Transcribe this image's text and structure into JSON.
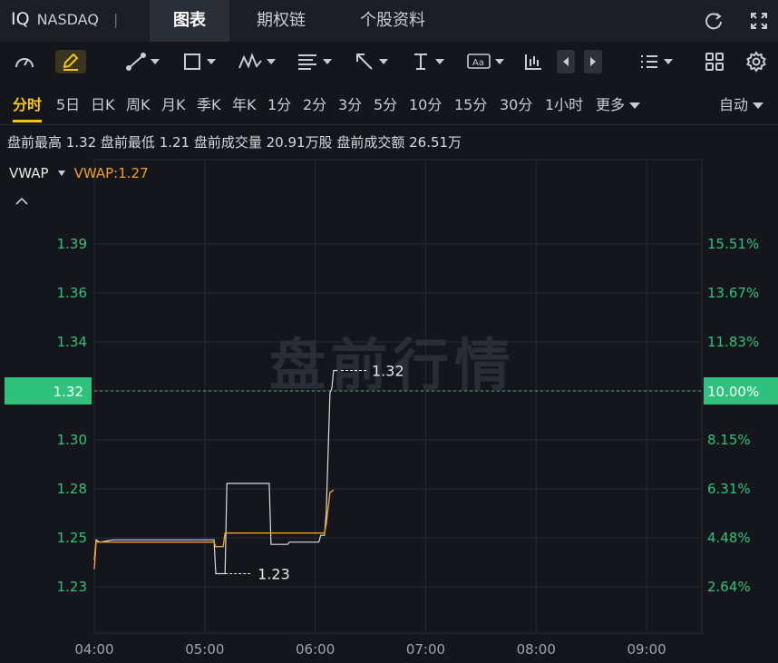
{
  "header": {
    "symbol": "IQ",
    "exchange": "NASDAQ",
    "separator": "|",
    "tabs": [
      {
        "label": "图表",
        "active": true
      },
      {
        "label": "期权链",
        "active": false
      },
      {
        "label": "个股资料",
        "active": false
      }
    ],
    "icons": [
      "refresh-icon",
      "fullscreen-icon"
    ]
  },
  "toolbar": {
    "tools": [
      "gauge-icon",
      "pencil-icon",
      "trend-line-icon",
      "rectangle-icon",
      "pattern-icon",
      "fibonacci-icon",
      "arrow-icon",
      "text-cursor-icon",
      "text-box-icon",
      "candles-icon",
      "prev-icon",
      "next-icon",
      "list-icon",
      "grid-icon",
      "settings-icon"
    ]
  },
  "periods": {
    "items": [
      "分时",
      "5日",
      "日K",
      "周K",
      "月K",
      "季K",
      "年K",
      "1分",
      "2分",
      "3分",
      "5分",
      "10分",
      "15分",
      "30分",
      "1小时",
      "更多"
    ],
    "active": "分时",
    "scale_mode": "自动"
  },
  "info": {
    "text": "盘前最高 1.32 盘前最低 1.21 盘前成交量 20.91万股 盘前成交额 26.51万"
  },
  "indicator": {
    "name": "VWAP",
    "value_text": "VWAP:1.27"
  },
  "chart_data": {
    "type": "line",
    "watermark": "盘前行情",
    "price_ticks": [
      "1.39",
      "1.36",
      "1.34",
      "1.32",
      "1.30",
      "1.28",
      "1.25",
      "1.23"
    ],
    "percent_ticks": [
      "15.51%",
      "13.67%",
      "11.83%",
      "10.00%",
      "8.15%",
      "6.31%",
      "4.48%",
      "2.64%"
    ],
    "x_ticks": [
      "04:00",
      "05:00",
      "06:00",
      "07:00",
      "08:00",
      "09:00"
    ],
    "current_price": "1.32",
    "current_percent": "10.00%",
    "high_label": "1.32",
    "low_label": "1.23",
    "ylim": [
      1.2037,
      1.4134
    ],
    "x_range_minutes": [
      240,
      570
    ],
    "series": [
      {
        "name": "",
        "color": "#d8dbe0",
        "points": [
          [
            240,
            1.236
          ],
          [
            241,
            1.245
          ],
          [
            243,
            1.244
          ],
          [
            250,
            1.245
          ],
          [
            305,
            1.245
          ],
          [
            306,
            1.23
          ],
          [
            310,
            1.23
          ],
          [
            311,
            1.23
          ],
          [
            312,
            1.27
          ],
          [
            318,
            1.27
          ],
          [
            335,
            1.27
          ],
          [
            336,
            1.243
          ],
          [
            345,
            1.243
          ],
          [
            346,
            1.244
          ],
          [
            362,
            1.244
          ],
          [
            363,
            1.247
          ],
          [
            365,
            1.247
          ],
          [
            366,
            1.257
          ],
          [
            368,
            1.31
          ],
          [
            369,
            1.312
          ],
          [
            370,
            1.32
          ],
          [
            372,
            1.32
          ]
        ]
      },
      {
        "name": "VWAP",
        "color": "#f0a020",
        "points": [
          [
            240,
            1.232
          ],
          [
            241,
            1.244
          ],
          [
            305,
            1.244
          ],
          [
            306,
            1.242
          ],
          [
            310,
            1.242
          ],
          [
            311,
            1.248
          ],
          [
            365,
            1.248
          ],
          [
            366,
            1.252
          ],
          [
            368,
            1.266
          ],
          [
            370,
            1.267
          ]
        ]
      }
    ],
    "colors": {
      "up": "#2ec27e",
      "vwap": "#f0a020",
      "price": "#d8dbe0",
      "grid": "#262930"
    }
  }
}
